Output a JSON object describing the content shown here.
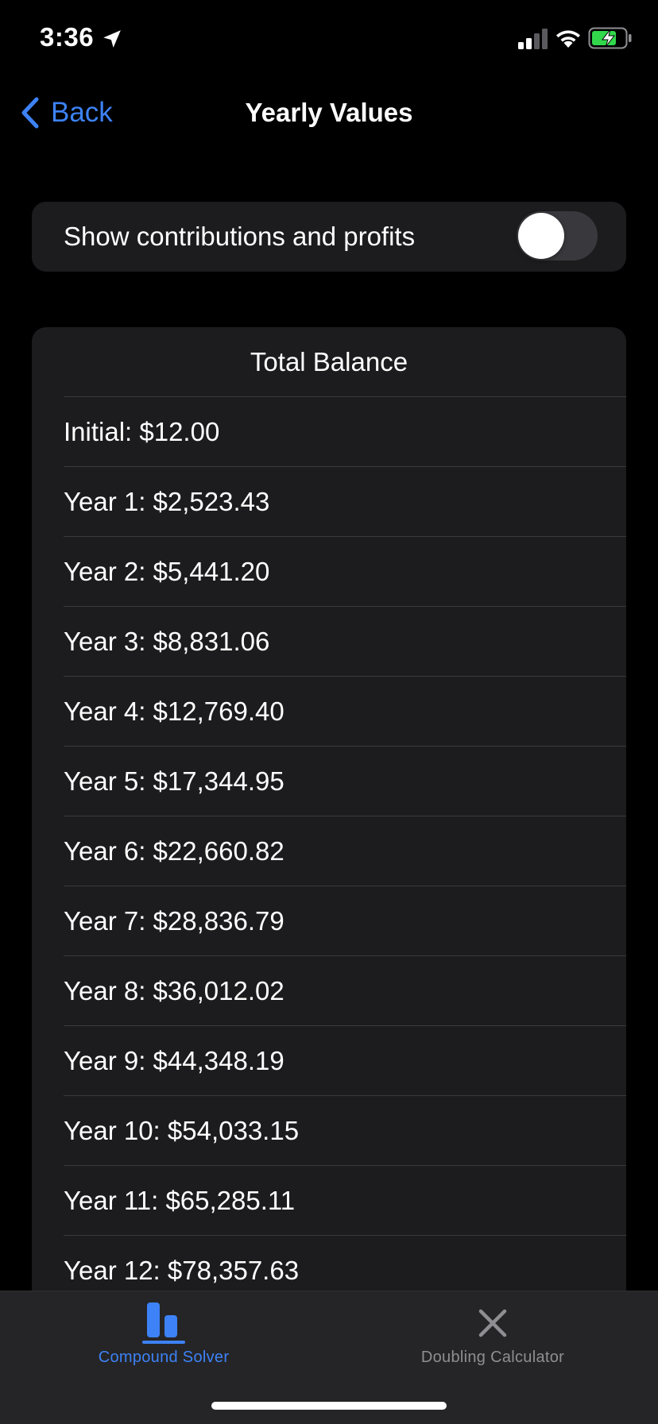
{
  "status_bar": {
    "time": "3:36",
    "icons": [
      "location-arrow-icon",
      "cellular-signal-icon",
      "wifi-icon",
      "battery-charging-icon"
    ],
    "battery_color": "#32d74b"
  },
  "nav": {
    "back_label": "Back",
    "title": "Yearly Values"
  },
  "settings": {
    "toggle_label": "Show contributions and profits",
    "toggle_on": false
  },
  "balance": {
    "header": "Total Balance",
    "rows": [
      "Initial: $12.00",
      "Year 1: $2,523.43",
      "Year 2: $5,441.20",
      "Year 3: $8,831.06",
      "Year 4: $12,769.40",
      "Year 5: $17,344.95",
      "Year 6: $22,660.82",
      "Year 7: $28,836.79",
      "Year 8: $36,012.02",
      "Year 9: $44,348.19",
      "Year 10: $54,033.15",
      "Year 11: $65,285.11",
      "Year 12: $78,357.63"
    ]
  },
  "tab_bar": {
    "tabs": [
      {
        "label": "Compound Solver",
        "icon": "bar-chart-icon",
        "selected": true
      },
      {
        "label": "Doubling Calculator",
        "icon": "close-x-icon",
        "selected": false
      }
    ]
  },
  "colors": {
    "accent": "#3d82f6",
    "background": "#000000",
    "card": "#1c1c1e",
    "tab_bar": "#252527",
    "inactive": "#8e8e93"
  }
}
